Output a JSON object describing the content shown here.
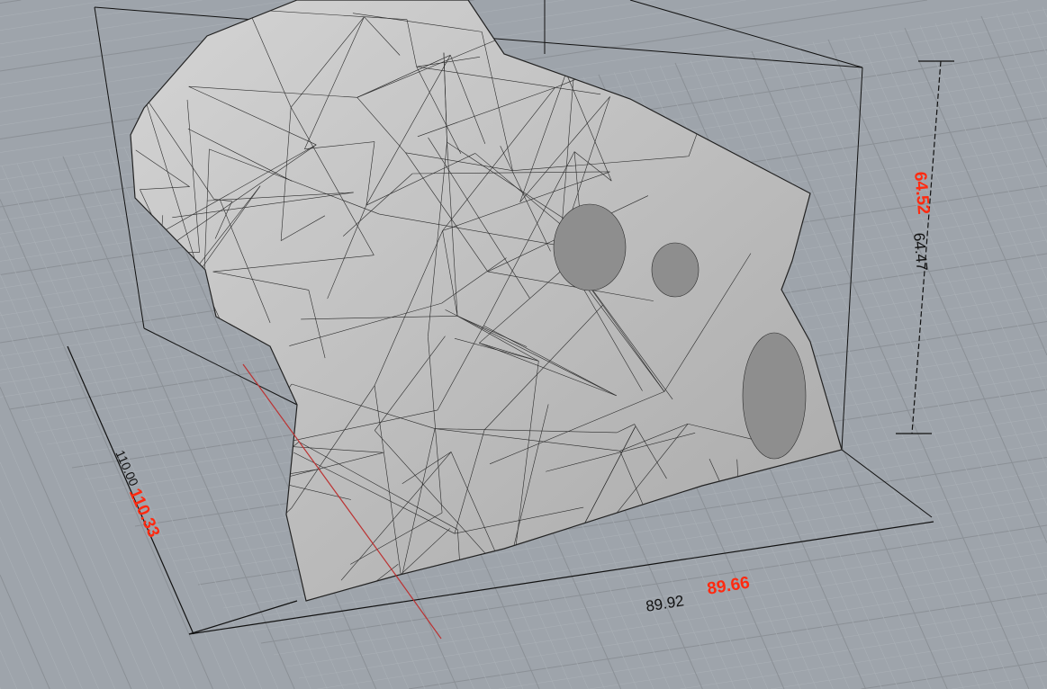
{
  "viewport": {
    "background": "#9ea4ab",
    "model": "mesh-engine-block",
    "dimensions": {
      "height_actual": "64.52",
      "height_nominal": "64.47",
      "length_actual": "110.33",
      "length_nominal": "110.00",
      "width_actual": "89.66",
      "width_nominal": "89.92"
    },
    "colors": {
      "actual": "#ff2a10",
      "nominal": "#111111",
      "mesh": "#c9c9c9"
    }
  }
}
